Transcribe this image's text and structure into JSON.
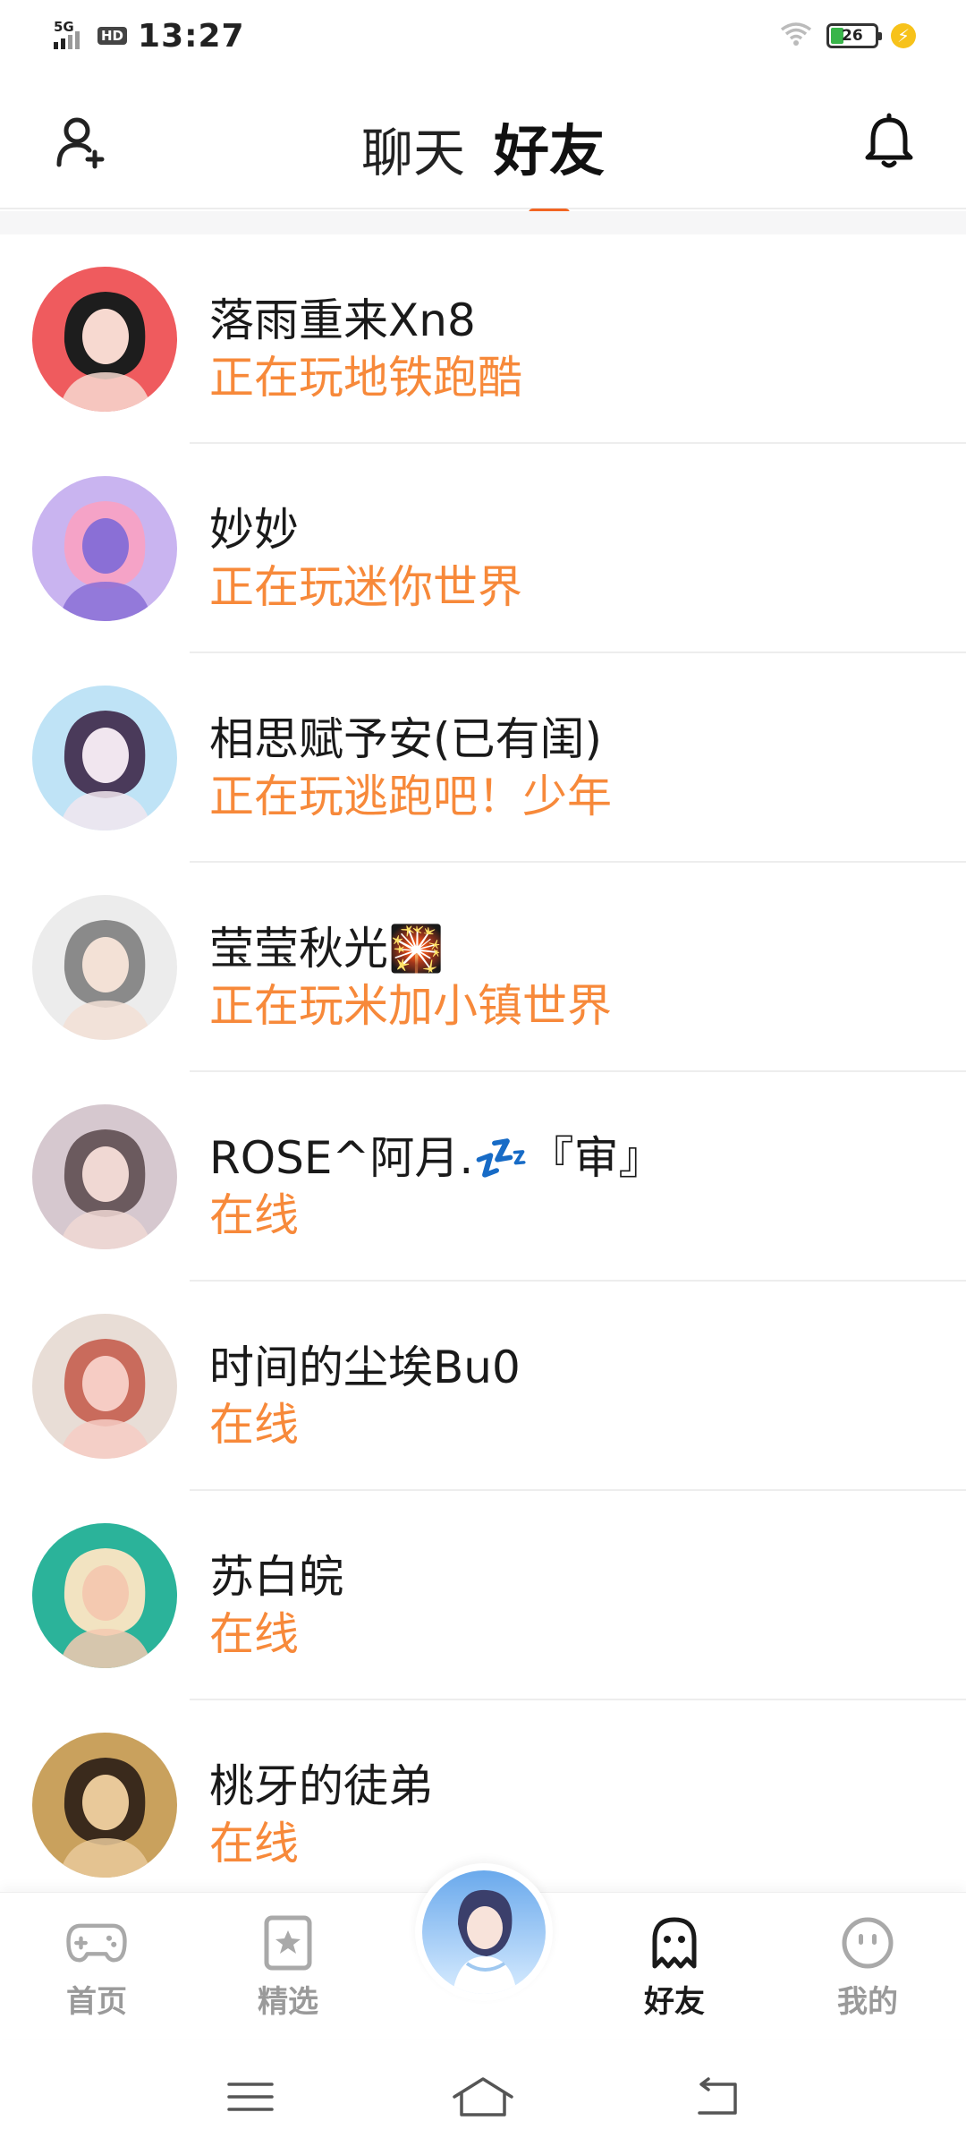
{
  "status_bar": {
    "network": "5G",
    "hd_badge": "HD",
    "time": "13:27",
    "battery_level": "26",
    "icons": [
      "signal-icon",
      "wifi-icon",
      "battery-icon",
      "charging-icon"
    ]
  },
  "header": {
    "tabs": [
      {
        "label": "聊天",
        "active": false
      },
      {
        "label": "好友",
        "active": true
      }
    ],
    "left_icon": "add-friend-icon",
    "right_icon": "bell-icon",
    "accent_color": "#f26522"
  },
  "friends": [
    {
      "name": "落雨重来Xn8",
      "status": "正在玩地铁跑酷",
      "avatar_colors": [
        "#ef5b5e",
        "#1d1d1d",
        "#f7d9d0"
      ]
    },
    {
      "name": "妙妙",
      "status": "正在玩迷你世界",
      "avatar_colors": [
        "#c9b4f0",
        "#f5a3c7",
        "#8a6fd6"
      ]
    },
    {
      "name": "相思赋予安(已有闺)",
      "status": "正在玩逃跑吧！少年",
      "avatar_colors": [
        "#bfe3f6",
        "#4a3a5a",
        "#f1e6ef"
      ]
    },
    {
      "name": "莹莹秋光🎇",
      "status": "正在玩米加小镇世界",
      "avatar_colors": [
        "#ececec",
        "#8a8a8a",
        "#f3e1d6"
      ]
    },
    {
      "name": "ROSE^阿月.💤『审』",
      "status": "在线",
      "avatar_colors": [
        "#d6c8cf",
        "#6b5a5e",
        "#f0d8d3"
      ]
    },
    {
      "name": "时间的尘埃Bu0",
      "status": "在线",
      "avatar_colors": [
        "#e8ddd6",
        "#c96b5c",
        "#f6ccc4"
      ]
    },
    {
      "name": "苏白皖",
      "status": "在线",
      "avatar_colors": [
        "#2bb39a",
        "#f2e3c1",
        "#f4c9b0"
      ]
    },
    {
      "name": "桃牙的徒弟",
      "status": "在线",
      "avatar_colors": [
        "#c9a15d",
        "#3a2a1c",
        "#e9c99a"
      ]
    }
  ],
  "status_color": "#f7893a",
  "bottom_nav": {
    "items": [
      {
        "label": "首页",
        "icon": "gamepad-icon",
        "active": false
      },
      {
        "label": "精选",
        "icon": "star-card-icon",
        "active": false
      },
      {
        "label": "好友",
        "icon": "ghost-icon",
        "active": true
      },
      {
        "label": "我的",
        "icon": "smiley-icon",
        "active": false
      }
    ],
    "center_icon": "featured-avatar"
  },
  "system_nav": {
    "icons": [
      "menu-icon",
      "home-icon",
      "back-icon"
    ]
  }
}
